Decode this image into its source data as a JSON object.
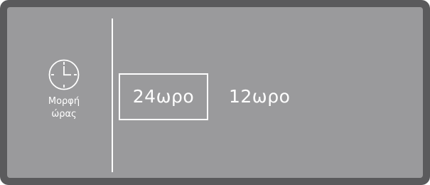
{
  "setting": {
    "icon": "clock-icon",
    "label_line1": "Μορφή",
    "label_line2": "ώρας"
  },
  "options": [
    {
      "label": "24ωρο",
      "selected": true
    },
    {
      "label": "12ωρο",
      "selected": false
    }
  ],
  "colors": {
    "bezel": "#5a5a5c",
    "screen": "#9a9a9c",
    "foreground": "#ffffff"
  }
}
